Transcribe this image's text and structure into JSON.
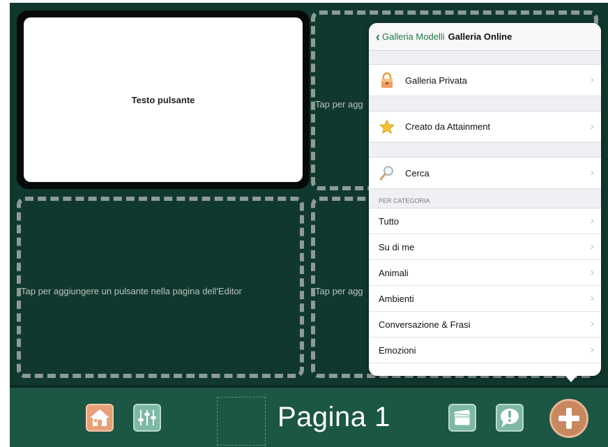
{
  "grid": {
    "button_text": "Testo pulsante",
    "placeholder_full": "Tap per aggiungere un pulsante nella pagina dell'Editor",
    "placeholder_short": "Tap per agg"
  },
  "popover": {
    "back_label": "Galleria Modelli",
    "title": "Galleria Online",
    "main_items": [
      {
        "label": "Galleria Privata",
        "icon": "lock-icon"
      },
      {
        "label": "Creato da Attainment",
        "icon": "star-icon"
      },
      {
        "label": "Cerca",
        "icon": "magnifier-icon"
      }
    ],
    "section_header": "PER CATEGORIA",
    "categories": [
      "Tutto",
      "Su di me",
      "Animali",
      "Ambienti",
      "Conversazione & Frasi",
      "Emozioni"
    ]
  },
  "toolbar": {
    "page_label": "Pagina 1",
    "icons": [
      "home-icon",
      "sliders-icon",
      "cards-icon",
      "speech-bubble-icon",
      "add-icon"
    ]
  },
  "colors": {
    "background": "#11382e",
    "toolbar": "#1c5644",
    "accent_green": "#1e7a47",
    "tool_button": "#e8a07a"
  }
}
